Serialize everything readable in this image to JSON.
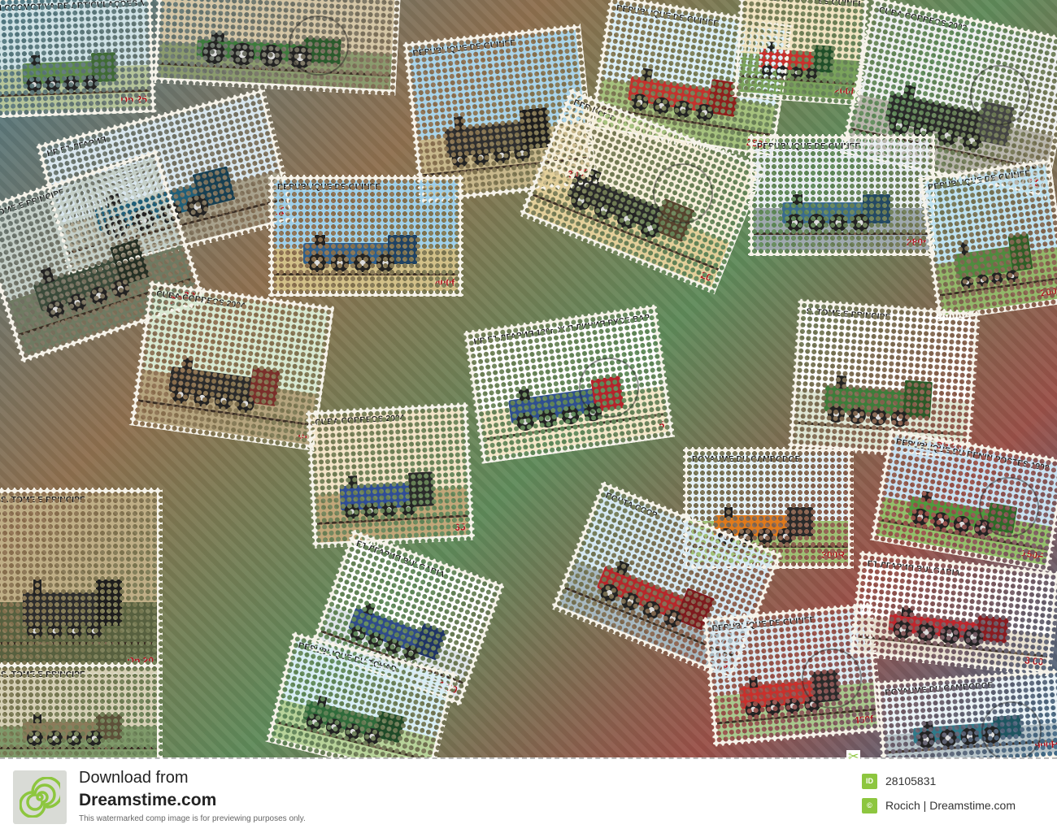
{
  "stamps": [
    {
      "caption": "LOCOMOTIVA DE ARTICULAÇÕES MALLET (1886 - 1903)",
      "denomination": "Db 25",
      "colors": {
        "sky": "#cfe2e6",
        "ground": "#b5c49a",
        "loco": "#5c8a49",
        "cab": "#3f6a35"
      }
    },
    {
      "caption": "БЪЛГАРИЯ BULGARIA",
      "denomination": "",
      "colors": {
        "sky": "#d5c6a6",
        "ground": "#8b9b6e",
        "loco": "#3d7a3c",
        "cab": "#2b5a2c"
      }
    },
    {
      "caption": "REPUBLIQUE DE GUINEE",
      "denomination": "300f",
      "colors": {
        "sky": "#a9d4ea",
        "ground": "#c8b88c",
        "loco": "#2f2f2f",
        "cab": "#1d1d1d"
      }
    },
    {
      "caption": "REPUBLIQUE DE GUINEE",
      "denomination": "250f",
      "colors": {
        "sky": "#dceff7",
        "ground": "#a6c27e",
        "loco": "#c4322d",
        "cab": "#8f1f1c"
      }
    },
    {
      "caption": "OFFICE DE POSTES GUINEE",
      "denomination": "200f",
      "colors": {
        "sky": "#f1e4c2",
        "ground": "#7aa35b",
        "loco": "#c9302c",
        "cab": "#1f4e28"
      }
    },
    {
      "caption": "CUBA CORREOS 2003",
      "denomination": "10",
      "colors": {
        "sky": "#eef0f1",
        "ground": "#b9b6ad",
        "loco": "#2a2a2a",
        "cab": "#444"
      }
    },
    {
      "caption": "НР БЪЛГАРИЯ",
      "denomination": "32",
      "colors": {
        "sky": "#d9e7ef",
        "ground": "#a8a18c",
        "loco": "#1f5e78",
        "cab": "#173f52"
      }
    },
    {
      "caption": "S. TOMÉ E PRÍNCIPE",
      "denomination": "Db 25",
      "colors": {
        "sky": "#c4cfc8",
        "ground": "#6f7a62",
        "loco": "#3a4a3a",
        "cab": "#242f24"
      }
    },
    {
      "caption": "REPUBLIQUE DE GUINEE",
      "denomination": "400f",
      "colors": {
        "sky": "#9fd0ea",
        "ground": "#d2c088",
        "loco": "#2f5f8c",
        "cab": "#1f4263"
      }
    },
    {
      "caption": "DPR Korea",
      "denomination": "20",
      "colors": {
        "sky": "#f7f0dc",
        "ground": "#e3cf9a",
        "loco": "#2a2a2a",
        "cab": "#56432e"
      }
    },
    {
      "caption": "REPUBLIQUE DE GUINEE",
      "denomination": "280f",
      "colors": {
        "sky": "#e9eef2",
        "ground": "#9fa9ae",
        "loco": "#3a6b8c",
        "cab": "#244963"
      }
    },
    {
      "caption": "REPUBLIQUE DE GUINEE",
      "denomination": "200f",
      "colors": {
        "sky": "#bfe3f2",
        "ground": "#93b86a",
        "loco": "#4f8b3e",
        "cab": "#2f5e26"
      }
    },
    {
      "caption": "CUBA CORREOS 2004",
      "denomination": "15",
      "colors": {
        "sky": "#d8e9d2",
        "ground": "#b6a57f",
        "loco": "#2b2b2b",
        "cab": "#7a2f2a"
      }
    },
    {
      "caption": "НР БЪЛГАРИЯ 120г. Ж.П ЛИНИЯ РУСЕ-ВАРНА-1986",
      "denomination": "5",
      "colors": {
        "sky": "#ffffff",
        "ground": "#f4e7c9",
        "loco": "#2e4f8f",
        "cab": "#b5232b"
      }
    },
    {
      "caption": "S. TOMÉ E PRÍNCIPE",
      "denomination": "Db 25",
      "colors": {
        "sky": "#ffffff",
        "ground": "#dfe6d4",
        "loco": "#3c7d3a",
        "cab": "#2a5a28"
      }
    },
    {
      "caption": "CUBA CORREOS 2004",
      "denomination": "65",
      "colors": {
        "sky": "#f3e4c8",
        "ground": "#c2a77a",
        "loco": "#2f4d96",
        "cab": "#2a2a2a"
      }
    },
    {
      "caption": "ROYAUME DU CAMBODGE",
      "denomination": "300R",
      "colors": {
        "sky": "#e4f1f6",
        "ground": "#9fbf74",
        "loco": "#e07a1c",
        "cab": "#2a2a2a"
      }
    },
    {
      "caption": "REPUBLIQUE DU BENIN POSTES 1998",
      "denomination": "150F",
      "colors": {
        "sky": "#c9e2f2",
        "ground": "#94c06b",
        "loco": "#4f9a3d",
        "cab": "#2d6a27"
      }
    },
    {
      "caption": "S. TOMÉ E PRINCIPE",
      "denomination": "Db 20",
      "colors": {
        "sky": "#bfae86",
        "ground": "#57603f",
        "loco": "#2d2d2d",
        "cab": "#1d1d1d"
      }
    },
    {
      "caption": "БЪЛГАРИЯ BULGARIA",
      "denomination": "1 00",
      "colors": {
        "sky": "#ffffff",
        "ground": "#dfe5ea",
        "loco": "#2f4a8a",
        "cab": "#1f3466"
      }
    },
    {
      "caption": "ПОЧТА СССР",
      "denomination": "6",
      "colors": {
        "sky": "#d6e9f3",
        "ground": "#a8b9c1",
        "loco": "#b8262a",
        "cab": "#7e1a1d"
      }
    },
    {
      "caption": "REPUBLIQUE DE GUINEE",
      "denomination": "450f",
      "colors": {
        "sky": "#dcebf2",
        "ground": "#a9c88e",
        "loco": "#c9302c",
        "cab": "#2a2a2a"
      }
    },
    {
      "caption": "БЪЛГАРИЯ BULGARIA",
      "denomination": "8 00",
      "colors": {
        "sky": "#ffffff",
        "ground": "#e9e2d2",
        "loco": "#c0262d",
        "cab": "#8a1b20"
      }
    },
    {
      "caption": "S. TOMÉ E PRINCIPE",
      "denomination": "",
      "colors": {
        "sky": "#d6d0b6",
        "ground": "#7f9a6a",
        "loco": "#8b7a5a",
        "cab": "#5d5039"
      }
    },
    {
      "caption": "REPUBLIQUE DU TCHAD",
      "denomination": "",
      "colors": {
        "sky": "#d8eef5",
        "ground": "#b8d39a",
        "loco": "#2f6a3a",
        "cab": "#1f4a28"
      }
    },
    {
      "caption": "ROYAUME DU CAMBODGE",
      "denomination": "900R",
      "colors": {
        "sky": "#eaf3f7",
        "ground": "#b7c4c9",
        "loco": "#2f7a8a",
        "cab": "#1d5560"
      }
    }
  ],
  "watermark": {
    "download_text": "Download from",
    "site_name": "Dreamstime.com",
    "note": "This watermarked comp image is for previewing purposes only.",
    "id_label": "ID",
    "id_value": "28105831",
    "author_value": "Rocich | Dreamstime.com",
    "logo_icon": "dreamstime-spiral-icon",
    "scissors_icon": "scissors-icon",
    "accent_color": "#8dc63f"
  }
}
